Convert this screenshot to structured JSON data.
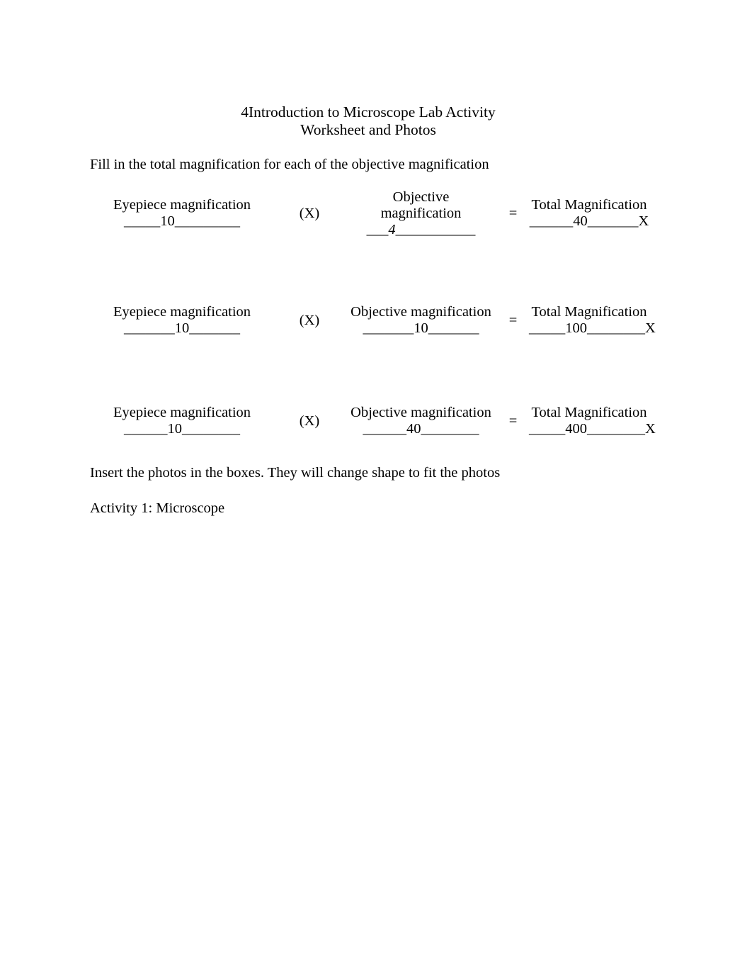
{
  "document": {
    "title_lines": [
      "4Introduction to Microscope Lab Activity",
      "Worksheet and Photos"
    ],
    "intro": "Fill in the total magnification for each of the objective magnification",
    "operators": {
      "multiply": "(X)",
      "equals": "="
    },
    "table": {
      "rows": [
        {
          "eyepiece_label": "Eyepiece magnification",
          "eyepiece_blank": "_____10_________",
          "multiply": "(X)",
          "objective_label_line1": "Objective",
          "objective_label_line2": "magnification",
          "objective_blank_pre": "___",
          "objective_value": "4",
          "objective_blank_post": "___________",
          "equals": "=",
          "total_label": "Total Magnification",
          "total_blank": "______40_______X",
          "total_value": "40"
        },
        {
          "eyepiece_label": "Eyepiece magnification",
          "eyepiece_blank": "_______10_______",
          "multiply": "(X)",
          "objective_label": "Objective magnification",
          "objective_blank": "_______10_______",
          "objective_value": "10",
          "equals": "=",
          "total_label": "Total Magnification",
          "total_blank": "_____100________X",
          "total_value": "100"
        },
        {
          "eyepiece_label": "Eyepiece magnification",
          "eyepiece_blank": "______10________",
          "multiply": "(X)",
          "objective_label": "Objective magnification",
          "objective_blank": "______40________",
          "objective_value": "40",
          "equals": "=",
          "total_label": "Total Magnification",
          "total_blank": "_____400________X",
          "total_value": "400"
        }
      ]
    },
    "paragraphs": {
      "insert_photos": "Insert the photos in the boxes. They will change shape to fit the photos",
      "activity": "Activity 1: Microscope"
    },
    "colors": {
      "page_background": "#ffffff",
      "text": "#000000"
    }
  }
}
